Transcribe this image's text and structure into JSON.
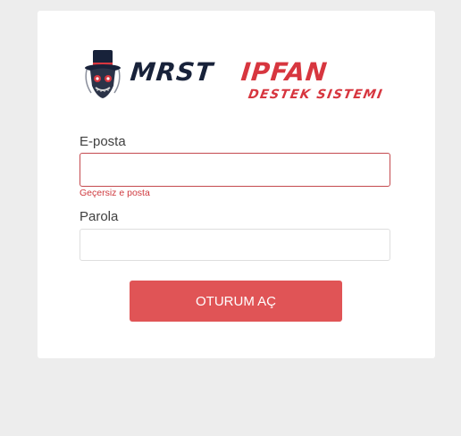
{
  "brand": {
    "name_part1": "MRST",
    "name_part2": "IPFAN",
    "subtitle": "DESTEK SISTEMI",
    "mascot_icon": "top-hat-skull-icon",
    "colors": {
      "dark": "#18223a",
      "accent": "#d7363f"
    }
  },
  "form": {
    "email": {
      "label": "E-posta",
      "value": "",
      "placeholder": "",
      "error": "Geçersiz e posta"
    },
    "password": {
      "label": "Parola",
      "value": "",
      "placeholder": ""
    },
    "submit_label": "OTURUM AÇ"
  },
  "colors": {
    "page_bg": "#ededed",
    "card_bg": "#ffffff",
    "button_bg": "#e05456",
    "error": "#cf3a3f"
  }
}
